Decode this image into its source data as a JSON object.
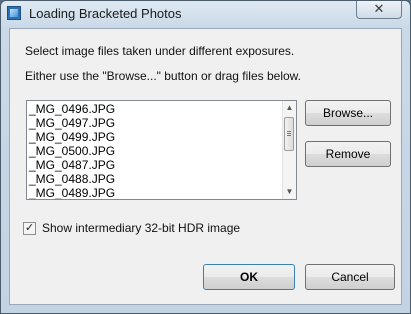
{
  "window": {
    "title": "Loading Bracketed Photos",
    "close_glyph": "✕"
  },
  "instructions": {
    "line1": "Select image files taken under different exposures.",
    "line2": "Either use the \"Browse...\" button or drag files below."
  },
  "files": [
    "_MG_0496.JPG",
    "_MG_0497.JPG",
    "_MG_0499.JPG",
    "_MG_0500.JPG",
    "_MG_0487.JPG",
    "_MG_0488.JPG",
    "_MG_0489.JPG"
  ],
  "buttons": {
    "browse": "Browse...",
    "remove": "Remove",
    "ok": "OK",
    "cancel": "Cancel"
  },
  "checkbox": {
    "label": "Show intermediary 32-bit HDR image",
    "checked": true,
    "glyph": "✓"
  },
  "scrollbar": {
    "up_glyph": "▲",
    "down_glyph": "▼"
  }
}
